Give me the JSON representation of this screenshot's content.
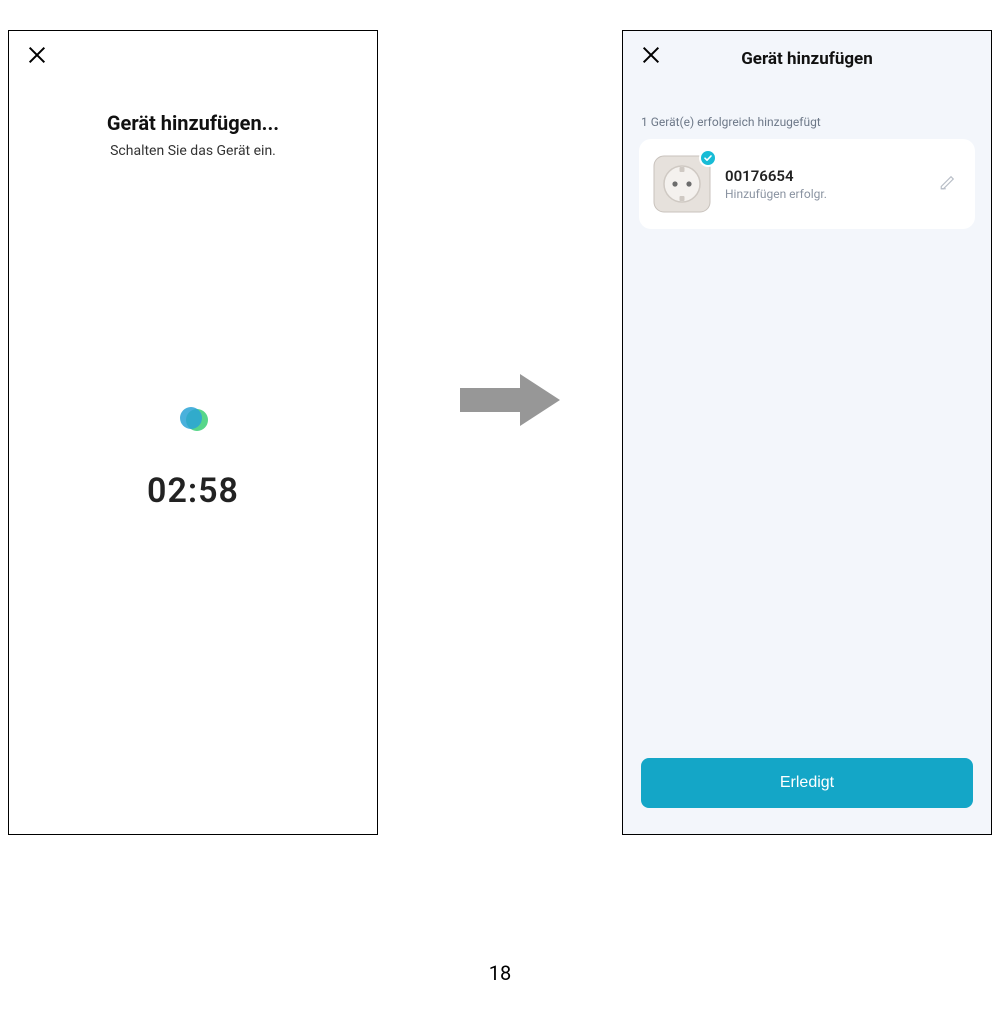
{
  "left_screen": {
    "title": "Gerät hinzufügen...",
    "subtitle": "Schalten Sie das Gerät ein.",
    "countdown": "02:58"
  },
  "right_screen": {
    "title": "Gerät hinzufügen",
    "status_line": "1 Gerät(e) erfolgreich hinzugefügt",
    "device": {
      "name": "00176654",
      "status": "Hinzufügen erfolgr."
    },
    "done_button": "Erledigt"
  },
  "page_number": "18"
}
